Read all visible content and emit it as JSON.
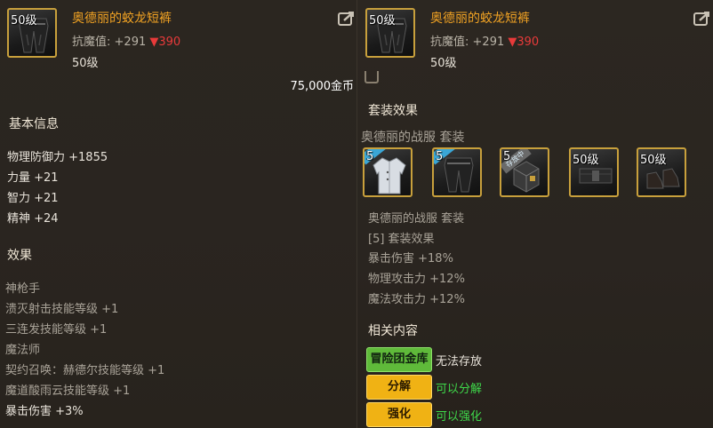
{
  "colors": {
    "item_name": "#f2a323",
    "stat_down": "#e83a3a",
    "frame_gold": "#c8a03c",
    "btn_green": "#5fba3a",
    "btn_yellow": "#f0b214",
    "desc_green": "#3fd84a"
  },
  "left": {
    "item": {
      "level_badge": "50级",
      "name": "奥德丽的蛟龙短裤",
      "stat_label": "抗魔值:",
      "stat_value": "+291",
      "stat_down": "▼390",
      "level": "50级",
      "icon": "pants-icon"
    },
    "price": "75,000金币",
    "basic_info": {
      "title": "基本信息",
      "lines": [
        "物理防御力 +1855",
        "力量 +21",
        "智力 +21",
        "精神 +24"
      ]
    },
    "effects": {
      "title": "效果",
      "lines": [
        "神枪手",
        "溃灭射击技能等级 +1",
        "三连发技能等级 +1",
        "魔法师",
        "契约召唤：赫德尔技能等级 +1",
        "魔道酸雨云技能等级 +1",
        "暴击伤害 +3%"
      ]
    }
  },
  "right": {
    "item": {
      "level_badge": "50级",
      "name": "奥德丽的蛟龙短裤",
      "stat_label": "抗魔值:",
      "stat_value": "+291",
      "stat_down": "▼390",
      "level": "50级",
      "icon": "pants-icon"
    },
    "set_effect": {
      "title": "套装效果",
      "set_name": "奥德丽的战服 套装",
      "slots": [
        {
          "badge": "5",
          "icon": "coat-icon",
          "ribbon": "blue"
        },
        {
          "badge": "5",
          "icon": "pants-icon",
          "ribbon": "blue"
        },
        {
          "badge": "5",
          "icon": "box-icon",
          "ribbon": "grey",
          "ribbon_text": "存放中"
        },
        {
          "badge": "50级",
          "icon": "belt-icon"
        },
        {
          "badge": "50级",
          "icon": "shoes-icon"
        }
      ],
      "lines_set_name": "奥德丽的战服 套装",
      "tier": "[5] 套装效果",
      "lines": [
        "暴击伤害 +18%",
        "物理攻击力 +12%",
        "魔法攻击力 +12%"
      ]
    },
    "related": {
      "title": "相关内容",
      "buttons": [
        {
          "label": "冒险团金库",
          "desc": "无法存放",
          "style": "green"
        },
        {
          "label": "分解",
          "desc": "可以分解",
          "style": "yellow"
        },
        {
          "label": "强化",
          "desc": "可以强化",
          "style": "yellow"
        }
      ]
    }
  }
}
